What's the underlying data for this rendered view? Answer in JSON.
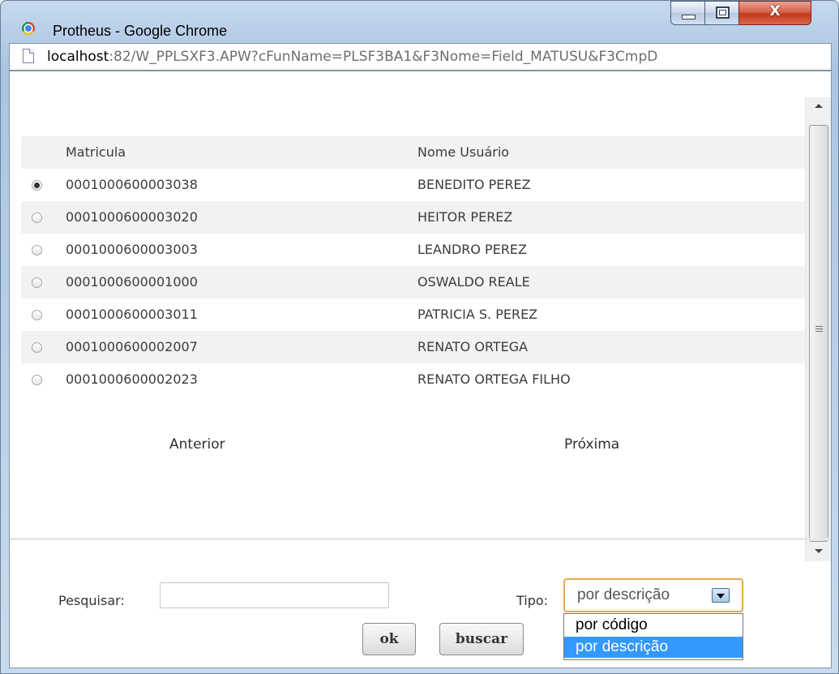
{
  "window": {
    "title": "Protheus - Google Chrome",
    "close_glyph": "X"
  },
  "address": {
    "host": "localhost",
    "rest": ":82/W_PPLSXF3.APW?cFunName=PLSF3BA1&F3Nome=Field_MATUSU&F3CmpD"
  },
  "table": {
    "headers": {
      "matricula": "Matricula",
      "nome": "Nome Usuário"
    },
    "rows": [
      {
        "matricula": "0001000600003038",
        "nome": "BENEDITO PEREZ",
        "selected": true
      },
      {
        "matricula": "0001000600003020",
        "nome": "HEITOR PEREZ",
        "selected": false
      },
      {
        "matricula": "0001000600003003",
        "nome": "LEANDRO PEREZ",
        "selected": false
      },
      {
        "matricula": "0001000600001000",
        "nome": "OSWALDO REALE",
        "selected": false
      },
      {
        "matricula": "0001000600003011",
        "nome": "PATRICIA S. PEREZ",
        "selected": false
      },
      {
        "matricula": "0001000600002007",
        "nome": "RENATO ORTEGA",
        "selected": false
      },
      {
        "matricula": "0001000600002023",
        "nome": "RENATO ORTEGA FILHO",
        "selected": false
      }
    ]
  },
  "pagination": {
    "prev": "Anterior",
    "next": "Próxima"
  },
  "search": {
    "label": "Pesquisar:",
    "value": "",
    "tipo_label": "Tipo:",
    "tipo_selected": "por descrição",
    "tipo_options": [
      "por código",
      "por descrição"
    ],
    "ok_label": "ok",
    "buscar_label": "buscar"
  },
  "colors": {
    "selection": "#3399ff",
    "focus_border": "#e6a94b"
  }
}
